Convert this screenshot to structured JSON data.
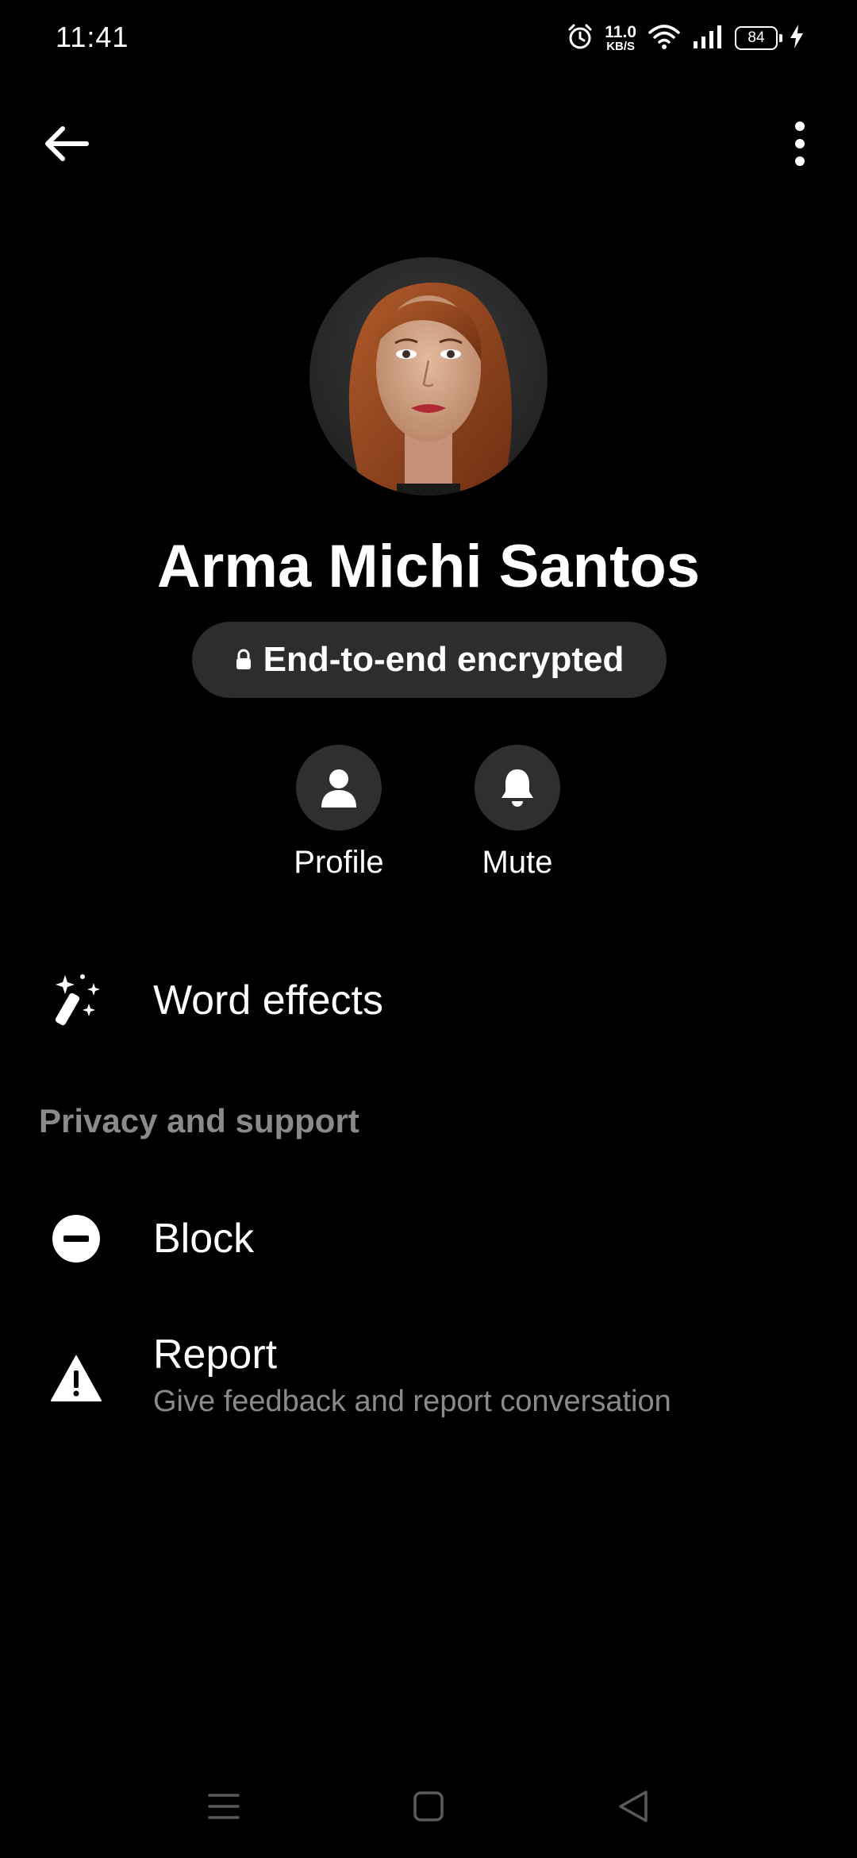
{
  "status_bar": {
    "time": "11:41",
    "net_speed_value": "11.0",
    "net_speed_unit": "KB/S",
    "battery": "84"
  },
  "header": {
    "back_icon": "arrow-left-icon",
    "more_icon": "more-vertical-icon"
  },
  "contact": {
    "name": "Arma Michi Santos",
    "encryption_label": "End-to-end encrypted"
  },
  "actions": [
    {
      "label": "Profile",
      "icon": "person-icon"
    },
    {
      "label": "Mute",
      "icon": "bell-icon"
    }
  ],
  "menu": {
    "word_effects": "Word effects",
    "section_privacy": "Privacy and support",
    "block": "Block",
    "report": "Report",
    "report_sub": "Give feedback and report conversation"
  },
  "colors": {
    "background": "#000000",
    "pill": "#2d2d2d",
    "secondary_text": "#8a8a8a"
  }
}
